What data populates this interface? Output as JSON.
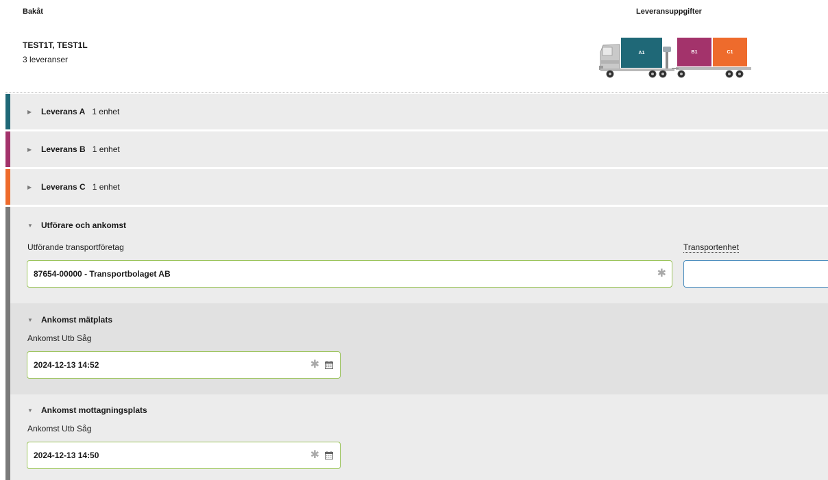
{
  "header": {
    "back_label": "Bakåt",
    "title": "Leveransuppgifter",
    "vehicle_id": "TEST1T, TEST1L",
    "delivery_count": "3 leveranser"
  },
  "truck": {
    "cargo": [
      {
        "label": "A1",
        "color": "#1f6877"
      },
      {
        "label": "B1",
        "color": "#a3336b"
      },
      {
        "label": "C1",
        "color": "#ee6b2c"
      }
    ]
  },
  "deliveries": [
    {
      "label": "Leverans A",
      "units": "1 enhet",
      "color": "#1f6877"
    },
    {
      "label": "Leverans B",
      "units": "1 enhet",
      "color": "#a3336b"
    },
    {
      "label": "Leverans C",
      "units": "1 enhet",
      "color": "#ee6b2c"
    }
  ],
  "performer": {
    "section_title": "Utförare och ankomst",
    "company_label": "Utförande transportföretag",
    "company_value": "87654-00000 - Transportbolaget AB",
    "transport_unit_label": "Transportenhet",
    "transport_unit_value": ""
  },
  "arrival_measure": {
    "section_title": "Ankomst mätplats",
    "field_label": "Ankomst Utb Såg",
    "value": "2024-12-13 14:52"
  },
  "arrival_receiving": {
    "section_title": "Ankomst mottagningsplats",
    "field_label": "Ankomst Utb Såg",
    "value": "2024-12-13 14:50"
  },
  "icons": {
    "expand": "triangle-right",
    "collapse": "triangle-down",
    "required": "asterisk",
    "calendar": "calendar-icon"
  },
  "colors": {
    "valid_border": "#9bc45a",
    "focus_border": "#4d8fbf",
    "section_accent": "#7a7a7a"
  }
}
